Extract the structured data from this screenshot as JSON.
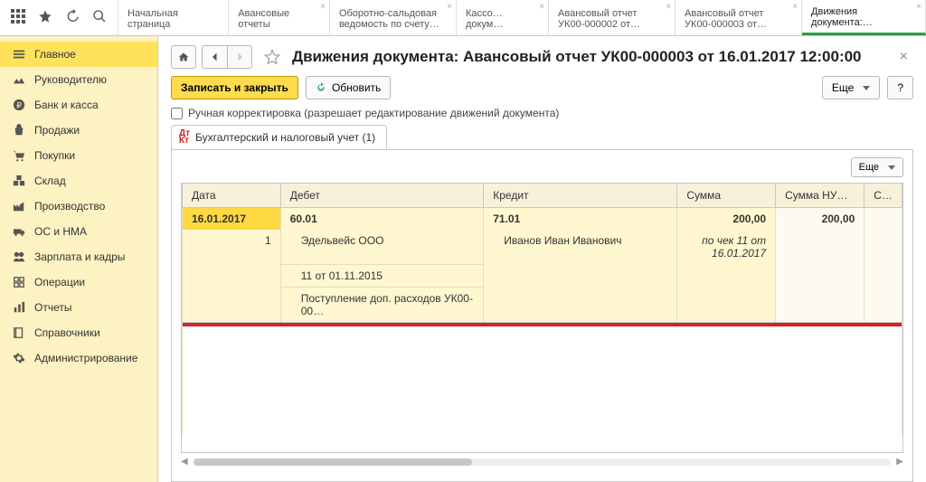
{
  "top_tabs": [
    "Начальная страница",
    "Авансовые отчеты",
    "Оборотно-сальдовая ведомость по счету…",
    "Кассо… докум…",
    "Авансовый отчет УК00-000002 от…",
    "Авансовый отчет УК00-000003 от…",
    "Движения документа:…"
  ],
  "sidebar": [
    {
      "label": "Главное",
      "icon": "menu"
    },
    {
      "label": "Руководителю",
      "icon": "trend"
    },
    {
      "label": "Банк и касса",
      "icon": "ruble"
    },
    {
      "label": "Продажи",
      "icon": "bag"
    },
    {
      "label": "Покупки",
      "icon": "cart"
    },
    {
      "label": "Склад",
      "icon": "boxes"
    },
    {
      "label": "Производство",
      "icon": "factory"
    },
    {
      "label": "ОС и НМА",
      "icon": "truck"
    },
    {
      "label": "Зарплата и кадры",
      "icon": "people"
    },
    {
      "label": "Операции",
      "icon": "ops"
    },
    {
      "label": "Отчеты",
      "icon": "chart"
    },
    {
      "label": "Справочники",
      "icon": "book"
    },
    {
      "label": "Администрирование",
      "icon": "gear"
    }
  ],
  "page": {
    "title": "Движения документа: Авансовый отчет УК00-000003 от 16.01.2017 12:00:00",
    "save_close": "Записать и закрыть",
    "refresh": "Обновить",
    "more": "Еще",
    "help": "?",
    "manual_edit": "Ручная корректировка (разрешает редактирование движений документа)",
    "inner_tab": "Бухгалтерский и налоговый учет (1)"
  },
  "grid": {
    "headers": [
      "Дата",
      "Дебет",
      "Кредит",
      "Сумма",
      "Сумма НУ…",
      "С…"
    ],
    "row_main": {
      "date": "16.01.2017",
      "debit": "60.01",
      "credit": "71.01",
      "sum": "200,00",
      "sum_nu": "200,00"
    },
    "row_seq": "1",
    "debit_lines": [
      "Эдельвейс ООО",
      "11 от 01.11.2015",
      "Поступление доп. расходов УК00-00…"
    ],
    "credit_sub": "Иванов Иван Иванович",
    "note": "по чек 11 от 16.01.2017"
  }
}
